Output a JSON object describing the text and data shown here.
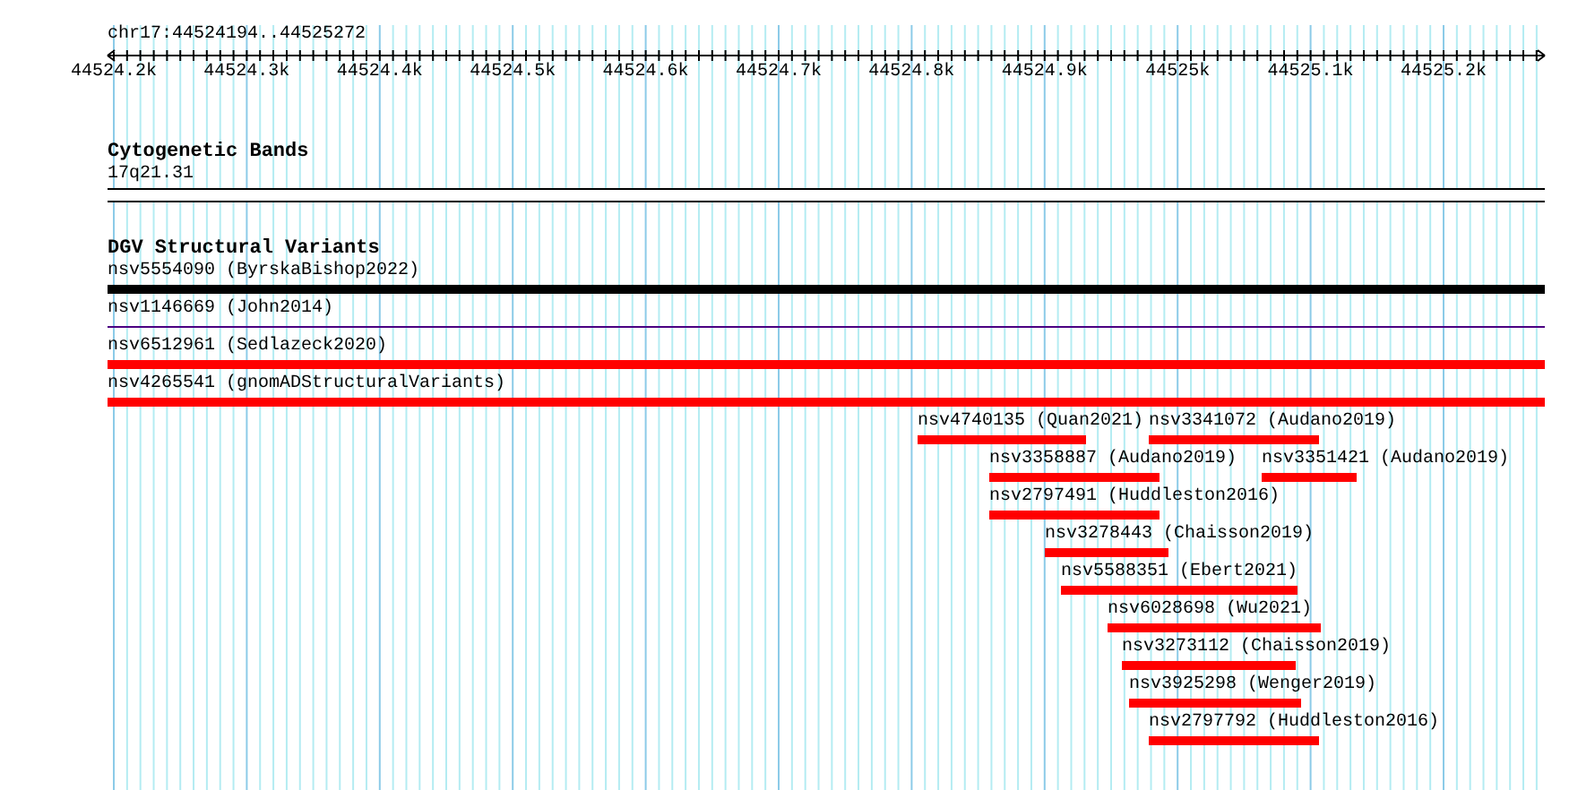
{
  "region": "chr17:44524194..44525272",
  "ruler": {
    "labels": [
      "44524.2k",
      "44524.3k",
      "44524.4k",
      "44524.5k",
      "44524.6k",
      "44524.7k",
      "44524.8k",
      "44524.9k",
      "44525k",
      "44525.1k",
      "44525.2k"
    ]
  },
  "cytogenetic_bands": {
    "title": "Cytogenetic Bands",
    "band": "17q21.31"
  },
  "dgv_structural_variants": {
    "title": "DGV Structural Variants",
    "features": [
      {
        "label": "nsv5554090 (ByrskaBishop2022)",
        "color": "#000000",
        "kind": "bar"
      },
      {
        "label": "nsv1146669 (John2014)",
        "color": "#4b0082",
        "kind": "line"
      },
      {
        "label": "nsv6512961 (Sedlazeck2020)",
        "color": "#ff0000",
        "kind": "bar"
      },
      {
        "label": "nsv4265541 (gnomADStructuralVariants)",
        "color": "#ff0000",
        "kind": "bar"
      },
      {
        "label": "nsv4740135 (Quan2021)",
        "color": "#ff0000",
        "kind": "bar"
      },
      {
        "label": "nsv3341072 (Audano2019)",
        "color": "#ff0000",
        "kind": "bar"
      },
      {
        "label": "nsv3358887 (Audano2019)",
        "color": "#ff0000",
        "kind": "bar"
      },
      {
        "label": "nsv3351421 (Audano2019)",
        "color": "#ff0000",
        "kind": "bar"
      },
      {
        "label": "nsv2797491 (Huddleston2016)",
        "color": "#ff0000",
        "kind": "bar"
      },
      {
        "label": "nsv3278443 (Chaisson2019)",
        "color": "#ff0000",
        "kind": "bar"
      },
      {
        "label": "nsv5588351 (Ebert2021)",
        "color": "#ff0000",
        "kind": "bar"
      },
      {
        "label": "nsv6028698 (Wu2021)",
        "color": "#ff0000",
        "kind": "bar"
      },
      {
        "label": "nsv3273112 (Chaisson2019)",
        "color": "#ff0000",
        "kind": "bar"
      },
      {
        "label": "nsv3925298 (Wenger2019)",
        "color": "#ff0000",
        "kind": "bar"
      },
      {
        "label": "nsv2797792 (Huddleston2016)",
        "color": "#ff0000",
        "kind": "bar"
      }
    ]
  }
}
